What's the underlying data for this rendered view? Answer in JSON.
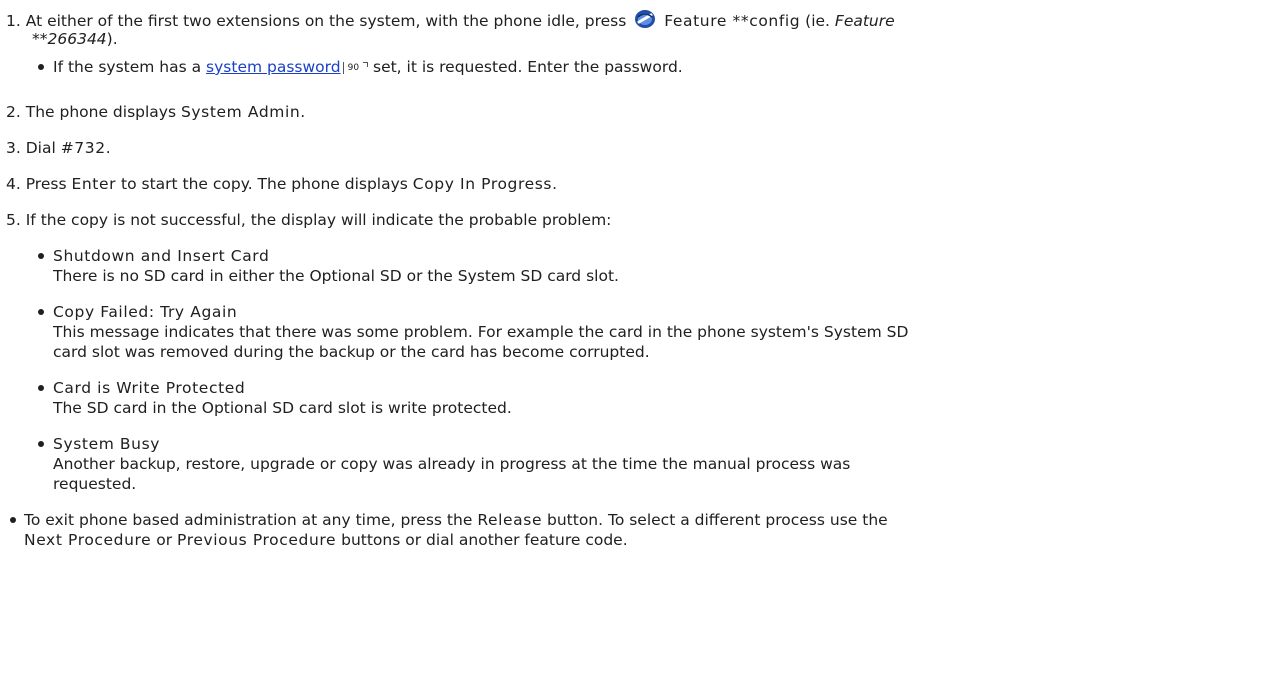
{
  "steps": {
    "s1": {
      "num": "1.",
      "text_before": "At either of the first two extensions on the system, with the phone idle, press",
      "feature_icon": "feature-button-icon",
      "code": "Feature **config",
      "after_code": " (ie. ",
      "example_code": "Feature",
      "example_code_2": "**266344",
      "close": ").",
      "sub_bullet": {
        "before": "If the system has a ",
        "link": "system password",
        "page_ref": "90",
        "after": " set, it is requested. Enter the password."
      }
    },
    "s2": {
      "num": "2.",
      "before": "The phone displays ",
      "display": "System Admin",
      "after": "."
    },
    "s3": {
      "num": "3.",
      "before": "Dial ",
      "display": "#732",
      "after": "."
    },
    "s4": {
      "num": "4.",
      "before": "Press ",
      "key": "Enter",
      "middle": " to start the copy. The phone displays ",
      "display": "Copy In Progress",
      "after": "."
    },
    "s5": {
      "num": "5.",
      "text": "If the copy is not successful, the display will indicate the probable problem:",
      "items": [
        {
          "title": "Shutdown and Insert Card",
          "desc": [
            "There is no SD card in either the Optional SD or the System SD card slot."
          ]
        },
        {
          "title": "Copy Failed: Try Again",
          "desc": [
            "This message indicates that there was some problem. For example the card in the phone system's System SD",
            "card slot was removed during the backup or the card has become corrupted."
          ]
        },
        {
          "title": "Card is Write Protected",
          "desc": [
            "The SD card in the Optional SD card slot is write protected."
          ]
        },
        {
          "title": "System Busy",
          "desc": [
            "Another backup, restore, upgrade or copy was already in progress at the time the manual process was",
            "requested."
          ]
        }
      ]
    }
  },
  "note": {
    "l1_before": "To exit phone based administration at any time, press the ",
    "l1_key": "Release",
    "l1_after": " button. To select a different process use the",
    "l2_key1": "Next Procedure",
    "l2_mid": " or ",
    "l2_key2": "Previous Procedure",
    "l2_after": " buttons or dial another feature code."
  }
}
